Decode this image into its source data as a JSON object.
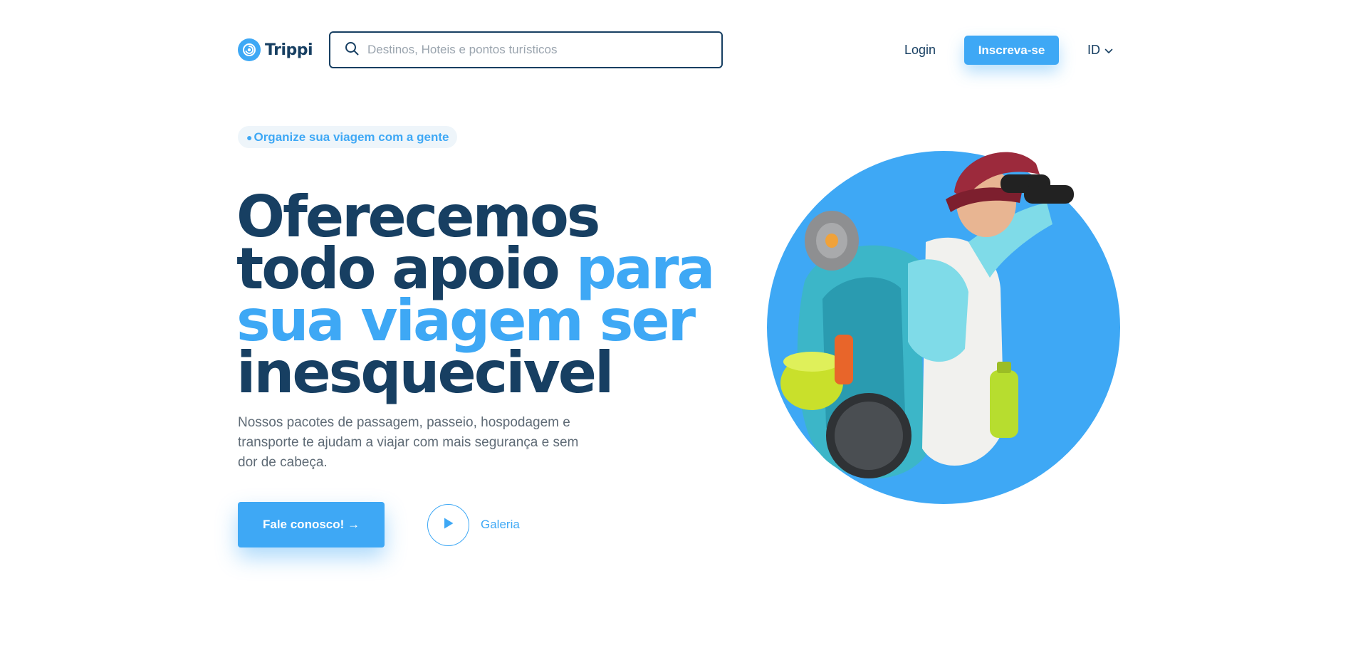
{
  "header": {
    "logo_text": "Trippi",
    "search_placeholder": "Destinos, Hoteis e pontos turísticos",
    "login_label": "Login",
    "signup_label": "Inscreva-se",
    "language": "ID"
  },
  "hero": {
    "badge": "Organize sua viagem com a gente",
    "headline": {
      "line1": "Oferecemos",
      "line2_dark": "todo apoio ",
      "line2_accent": "para",
      "line3_accent": "sua viagem ser",
      "line4": "inesquecivel"
    },
    "description": "Nossos pacotes de passagem, passeio, hospodagem e transporte te ajudam a viajar com mais segurança e sem dor de cabeça.",
    "cta_label": "Fale conosco! →",
    "gallery_label": "Galeria"
  },
  "colors": {
    "brand": "#3ea8f5",
    "navy": "#173f62",
    "text_muted": "#5f6b76"
  },
  "icons": [
    "trippi-logo-icon",
    "search-icon",
    "chevron-down-icon",
    "play-icon"
  ]
}
